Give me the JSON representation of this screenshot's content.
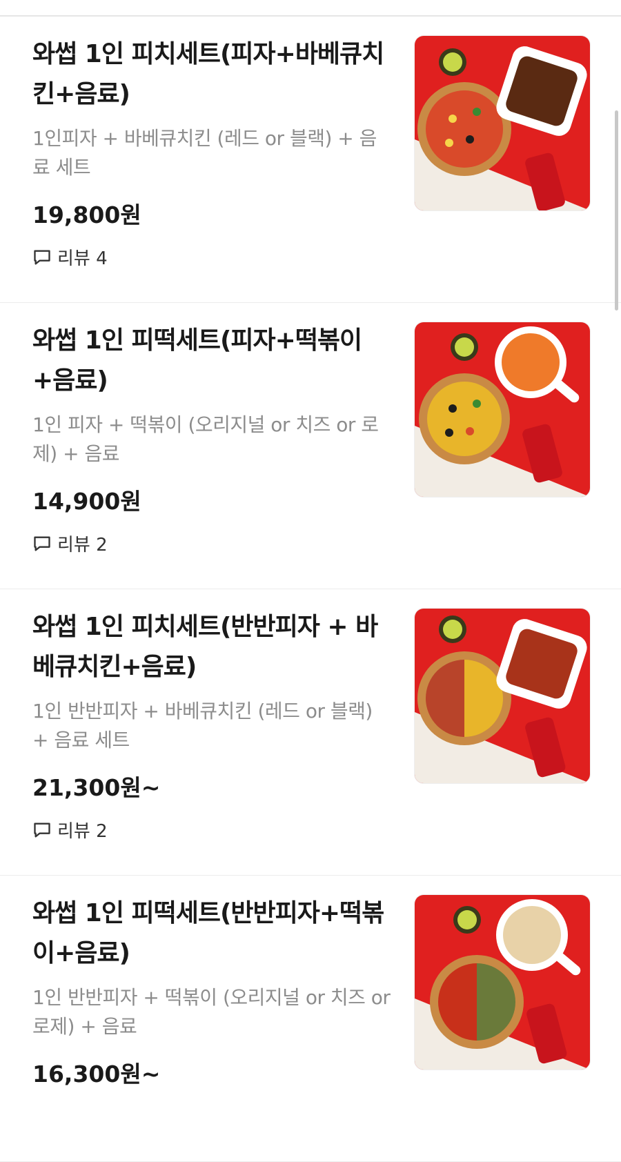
{
  "menu_items": [
    {
      "title": "와썹 1인 피치세트(피자+바베큐치킨+음료)",
      "description": "1인피자 + 바베큐치킨 (레드 or 블랙) + 음료 세트",
      "price": "19,800원",
      "review_label": "리뷰 4",
      "image": "pizza-chicken-cola-photo"
    },
    {
      "title": "와썹 1인 피떡세트(피자+떡볶이+음료)",
      "description": "1인 피자 + 떡볶이 (오리지널 or 치즈 or 로제) + 음료",
      "price": "14,900원",
      "review_label": "리뷰 2",
      "image": "pizza-tteokbokki-cola-photo"
    },
    {
      "title": "와썹 1인 피치세트(반반피자 + 바베큐치킨+음료)",
      "description": "1인 반반피자 + 바베큐치킨 (레드 or 블랙) + 음료 세트",
      "price": "21,300원~",
      "review_label": "리뷰 2",
      "image": "half-pizza-chicken-cola-photo"
    },
    {
      "title": "와썹 1인 피떡세트(반반피자+떡볶이+음료)",
      "description": "1인 반반피자 + 떡볶이 (오리지널 or 치즈 or 로제) + 음료",
      "price": "16,300원~",
      "review_label": "",
      "image": "half-pizza-tteokbokki-cola-photo"
    }
  ],
  "icons": {
    "review": "speech-bubble-icon"
  },
  "colors": {
    "background": "#ffffff",
    "photo_red": "#e0201f",
    "description_gray": "#8c8c8c"
  }
}
